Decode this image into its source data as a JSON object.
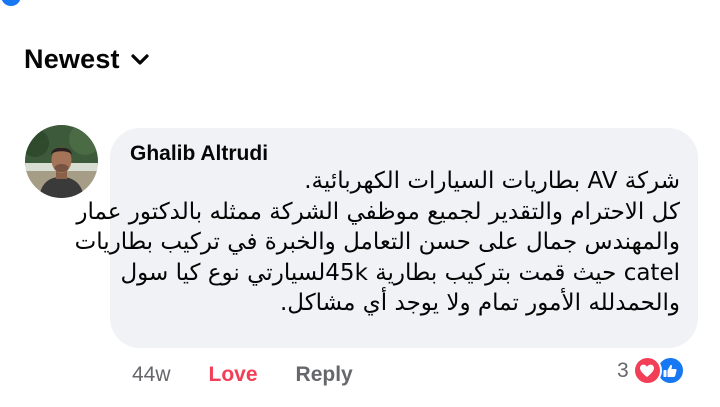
{
  "colors": {
    "accent": "#1877f2",
    "love": "#f33e58",
    "bubble_bg": "#f0f2f5",
    "secondary_text": "#65676b",
    "primary_text": "#050505"
  },
  "sort": {
    "label": "Newest",
    "icon": "chevron-down-icon"
  },
  "comment": {
    "author": "Ghalib Altrudi",
    "avatar_icon": "user-profile-photo",
    "lines": [
      "شركة AV بطاريات السيارات الكهربائية.",
      "كل الاحترام والتقدير لجميع موظفي الشركة ممثله بالدكتور عمار",
      "والمهندس جمال على حسن التعامل والخبرة في تركيب بطاريات",
      "catel حيث قمت بتركيب بطارية 45kلسيارتي نوع كيا سول",
      "والحمدلله الأمور تمام ولا يوجد أي مشاكل."
    ],
    "time": "44w",
    "love_label": "Love",
    "reply_label": "Reply",
    "reaction_count": "3",
    "reaction_icons": [
      "heart-icon",
      "like-icon"
    ]
  }
}
